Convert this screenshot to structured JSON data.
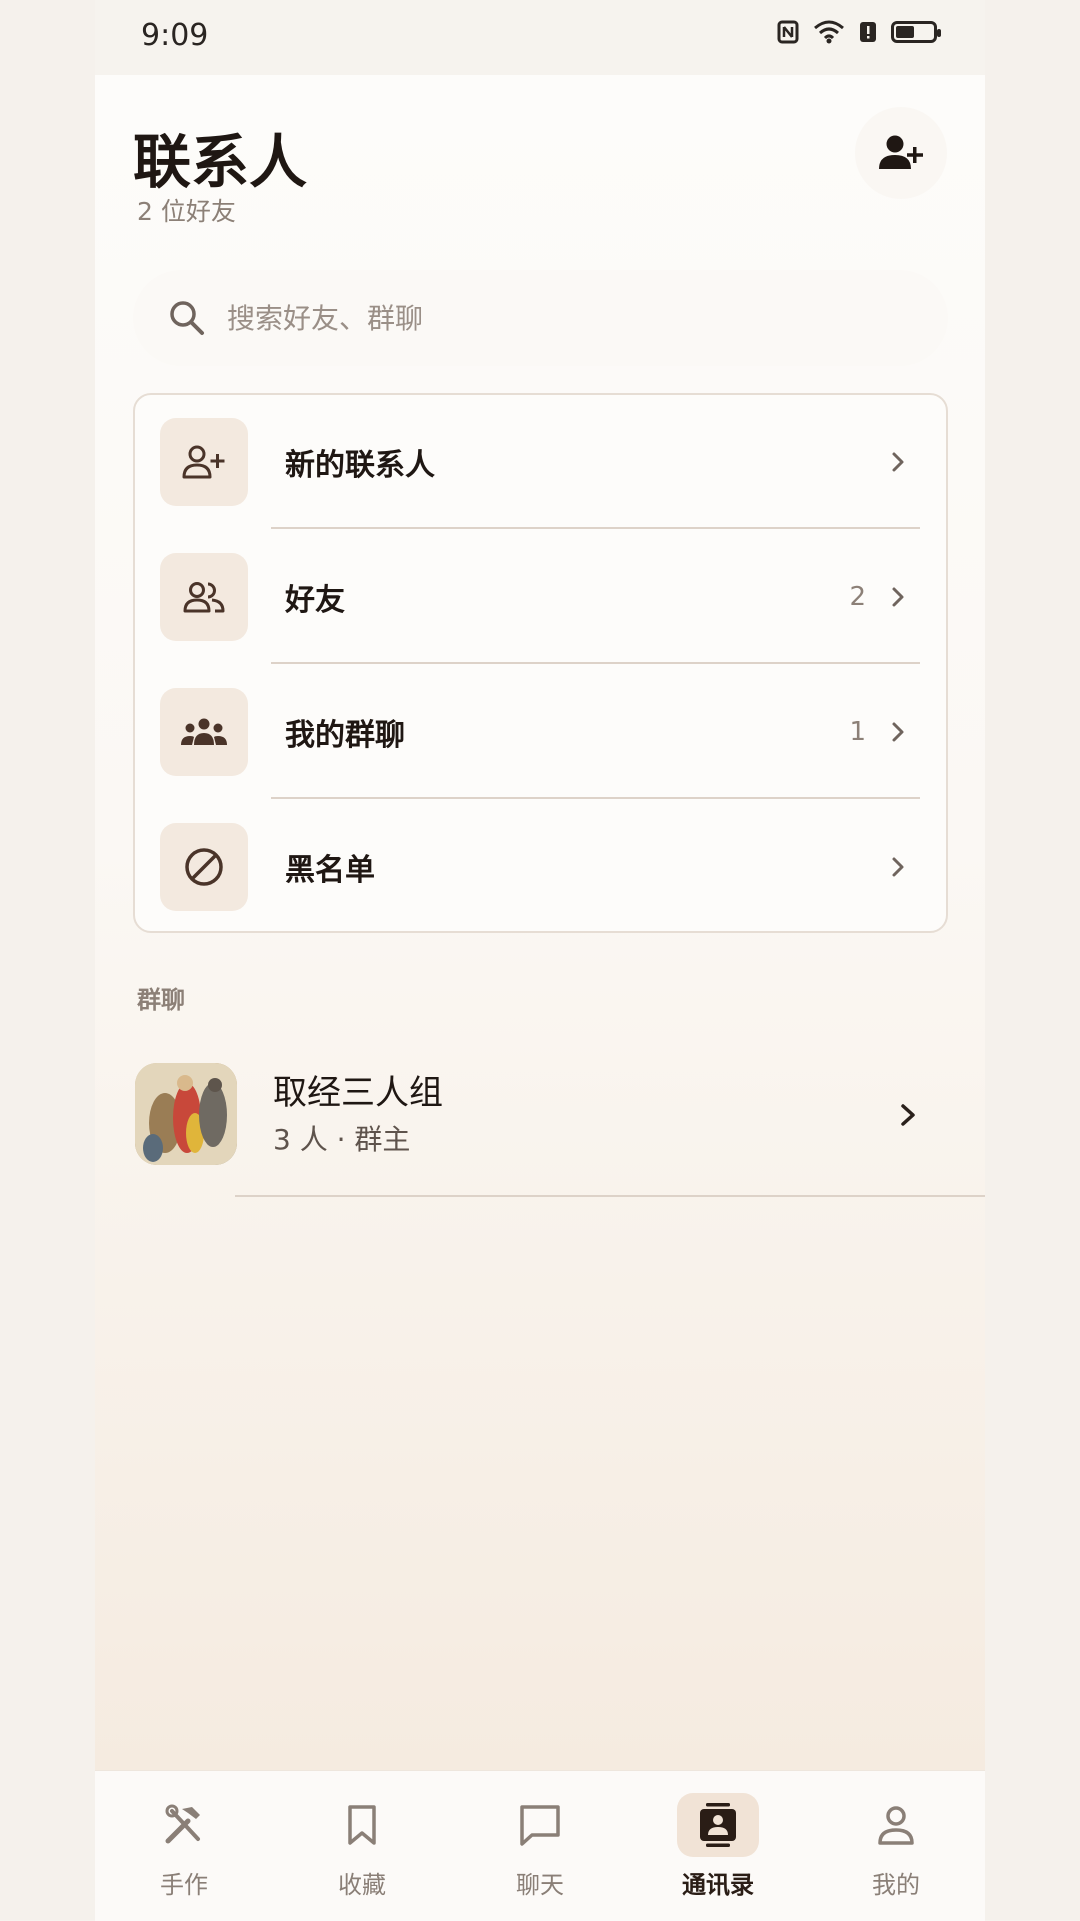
{
  "status_bar": {
    "time": "9:09",
    "icons": [
      "nfc-icon",
      "wifi-icon",
      "alert-icon",
      "battery-icon"
    ]
  },
  "header": {
    "title": "联系人",
    "subtitle": "2 位好友",
    "add_icon": "add-friend-icon"
  },
  "search": {
    "placeholder": "搜索好友、群聊"
  },
  "menu": {
    "items": [
      {
        "label": "新的联系人",
        "count": "",
        "icon": "add-person-icon"
      },
      {
        "label": "好友",
        "count": "2",
        "icon": "people-icon"
      },
      {
        "label": "我的群聊",
        "count": "1",
        "icon": "group-icon"
      },
      {
        "label": "黑名单",
        "count": "",
        "icon": "block-icon"
      }
    ]
  },
  "groups": {
    "section_label": "群聊",
    "items": [
      {
        "name": "取经三人组",
        "meta": "3 人 · 群主"
      }
    ]
  },
  "tabbar": {
    "tabs": [
      {
        "label": "手作",
        "icon": "tools-icon"
      },
      {
        "label": "收藏",
        "icon": "bookmark-icon"
      },
      {
        "label": "聊天",
        "icon": "chat-icon"
      },
      {
        "label": "通讯录",
        "icon": "contacts-icon",
        "active": true
      },
      {
        "label": "我的",
        "icon": "profile-icon"
      }
    ]
  },
  "colors": {
    "accent": "#f1e3d6",
    "icon_brown": "#4a3429",
    "text_dark": "#1f1713"
  }
}
